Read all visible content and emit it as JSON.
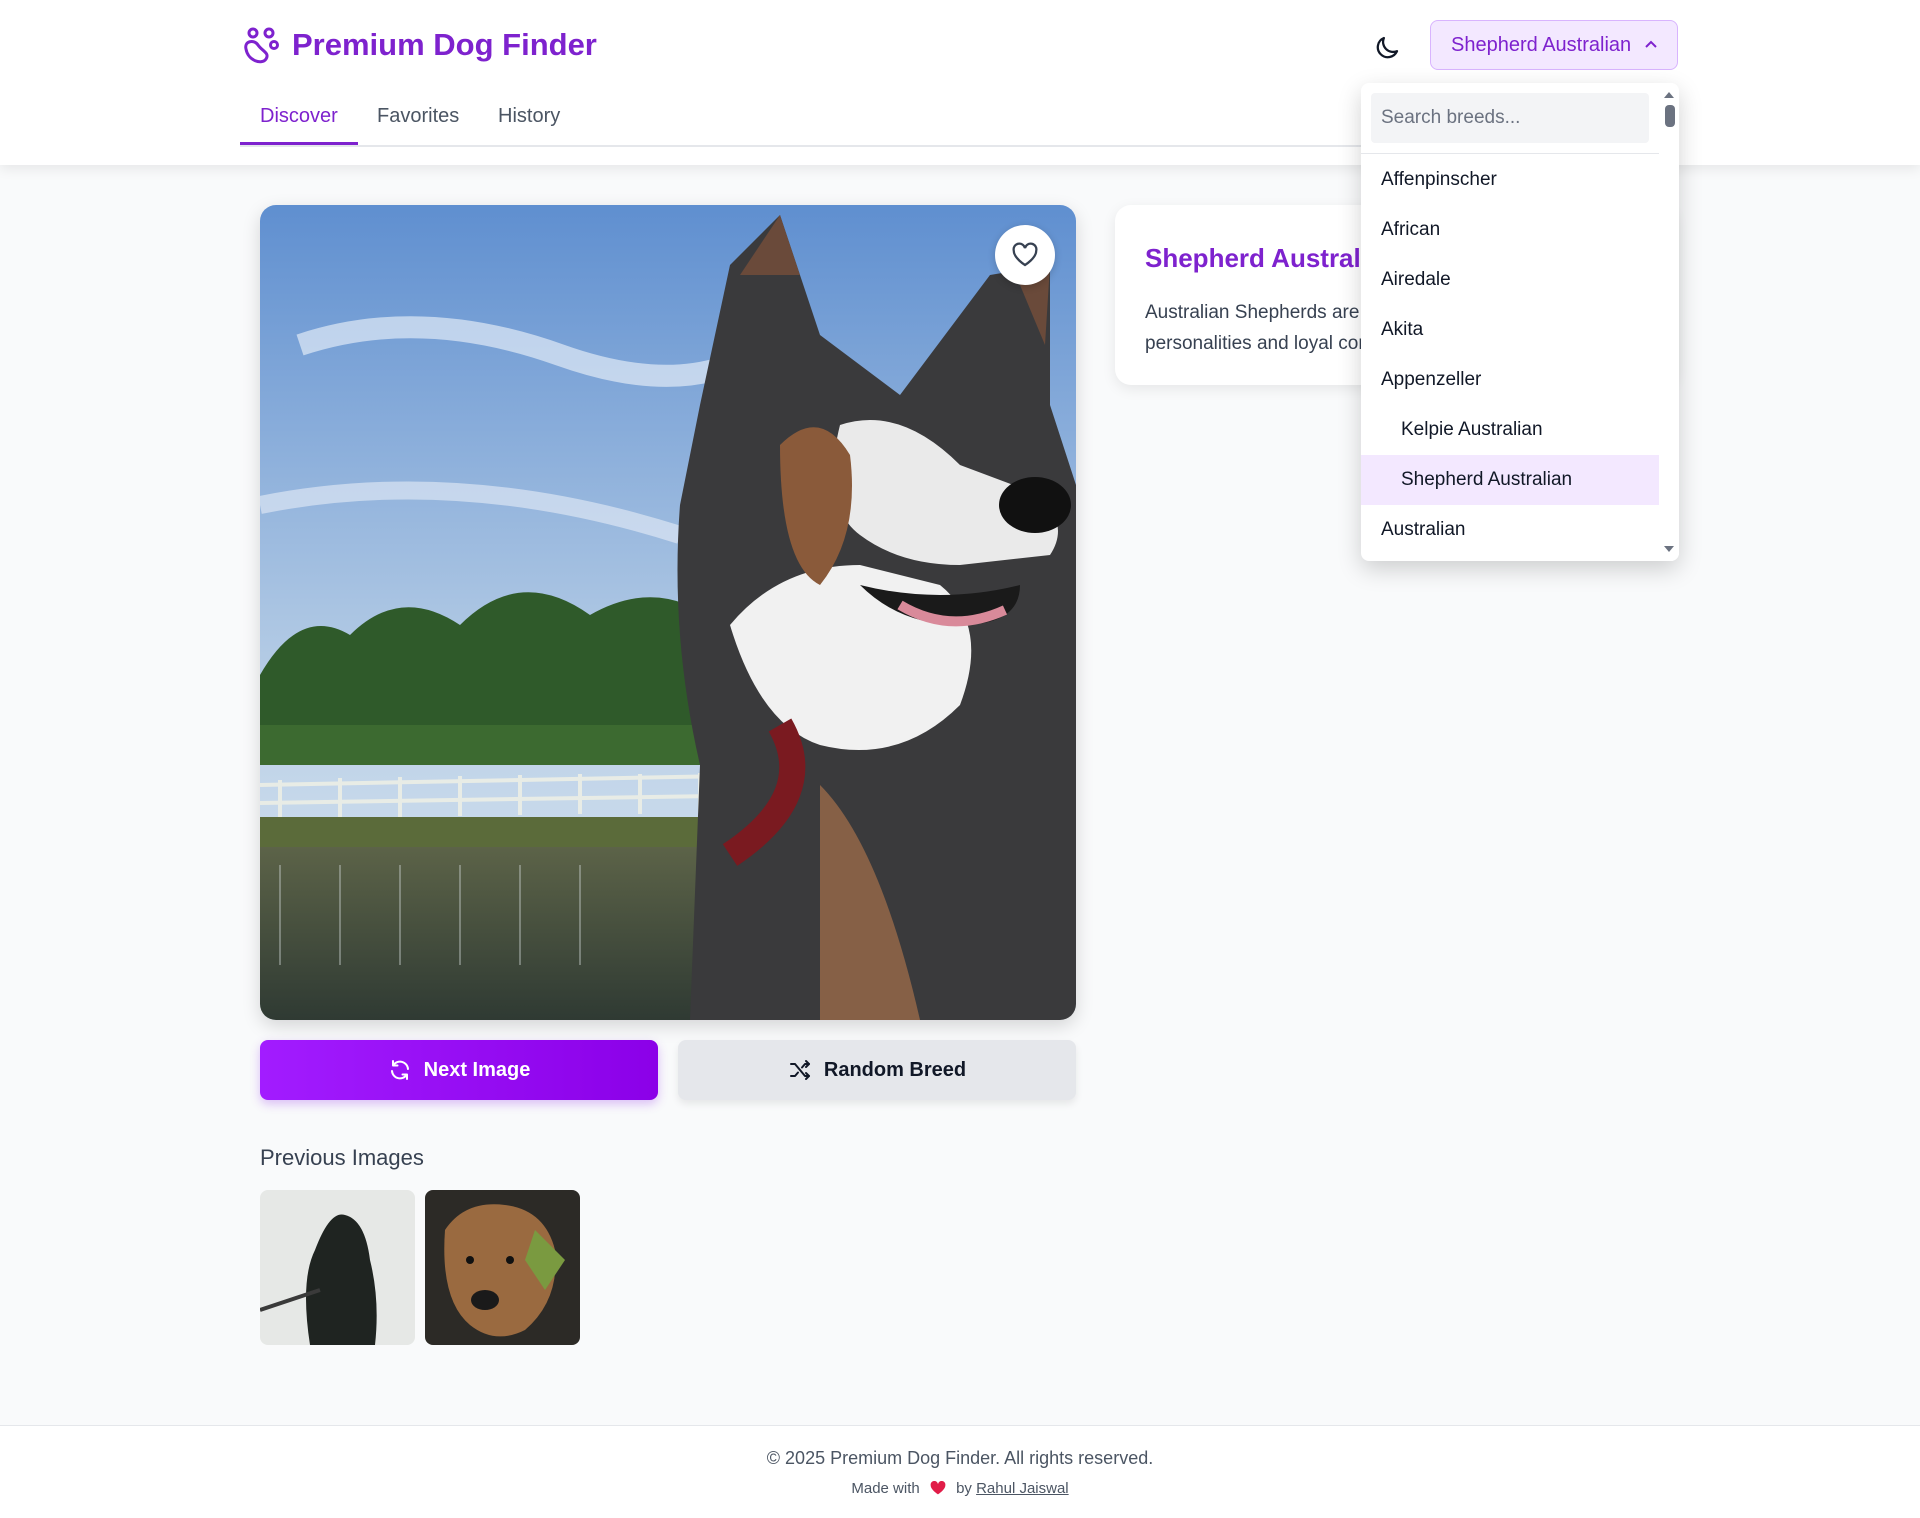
{
  "app": {
    "title": "Premium Dog Finder",
    "accent_color": "#7e22ce"
  },
  "header": {
    "theme_toggle_icon": "moon-icon",
    "breed_select": {
      "value": "Shepherd Australian",
      "icon": "chevron-up-icon"
    }
  },
  "tabs": [
    {
      "label": "Discover",
      "active": true
    },
    {
      "label": "Favorites",
      "active": false
    },
    {
      "label": "History",
      "active": false
    }
  ],
  "dropdown": {
    "search_placeholder": "Search breeds...",
    "items": [
      {
        "label": "Affenpinscher",
        "sub": false,
        "selected": false
      },
      {
        "label": "African",
        "sub": false,
        "selected": false
      },
      {
        "label": "Airedale",
        "sub": false,
        "selected": false
      },
      {
        "label": "Akita",
        "sub": false,
        "selected": false
      },
      {
        "label": "Appenzeller",
        "sub": false,
        "selected": false
      },
      {
        "label": "Kelpie Australian",
        "sub": true,
        "selected": false
      },
      {
        "label": "Shepherd Australian",
        "sub": true,
        "selected": true
      },
      {
        "label": "Australian",
        "sub": false,
        "selected": false
      }
    ]
  },
  "main_image": {
    "favorite_icon": "heart-outline-icon"
  },
  "actions": {
    "next_label": "Next Image",
    "next_icon": "refresh-icon",
    "random_label": "Random Breed",
    "random_icon": "shuffle-icon"
  },
  "breed_info": {
    "title": "Shepherd Australian",
    "description": "Australian Shepherds are known for their friendly personalities and loyal companionship."
  },
  "previous": {
    "title": "Previous Images"
  },
  "footer": {
    "copyright": "© 2025 Premium Dog Finder. All rights reserved.",
    "made_with": "Made with",
    "by": "by",
    "author": "Rahul Jaiswal",
    "heart_color": "#e11d48"
  }
}
